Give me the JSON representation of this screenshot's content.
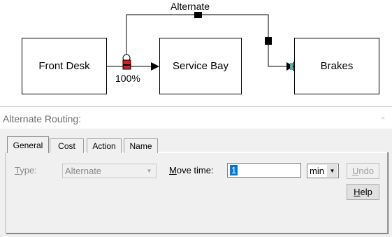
{
  "flow": {
    "nodes": {
      "front_desk": "Front Desk",
      "service_bay": "Service Bay",
      "brakes": "Brakes"
    },
    "route_label": "Alternate",
    "percent_label": "100%"
  },
  "dialog": {
    "title": "Alternate Routing:",
    "close_glyph": "×",
    "tabs": [
      {
        "label": "General",
        "active": true
      },
      {
        "label": "Cost",
        "active": false
      },
      {
        "label": "Action",
        "active": false
      },
      {
        "label": "Name",
        "active": false
      }
    ],
    "type_label_first": "T",
    "type_label_rest": "ype:",
    "type_value": "Alternate",
    "move_time_label_first": "M",
    "move_time_label_rest": "ove time:",
    "move_time_value": "1",
    "unit_value": "min",
    "undo_label_first": "U",
    "undo_label_rest": "ndo",
    "help_label_first": "H",
    "help_label_rest": "elp"
  },
  "colors": {
    "selection": "#0078d7",
    "marker_red": "#d62020"
  }
}
